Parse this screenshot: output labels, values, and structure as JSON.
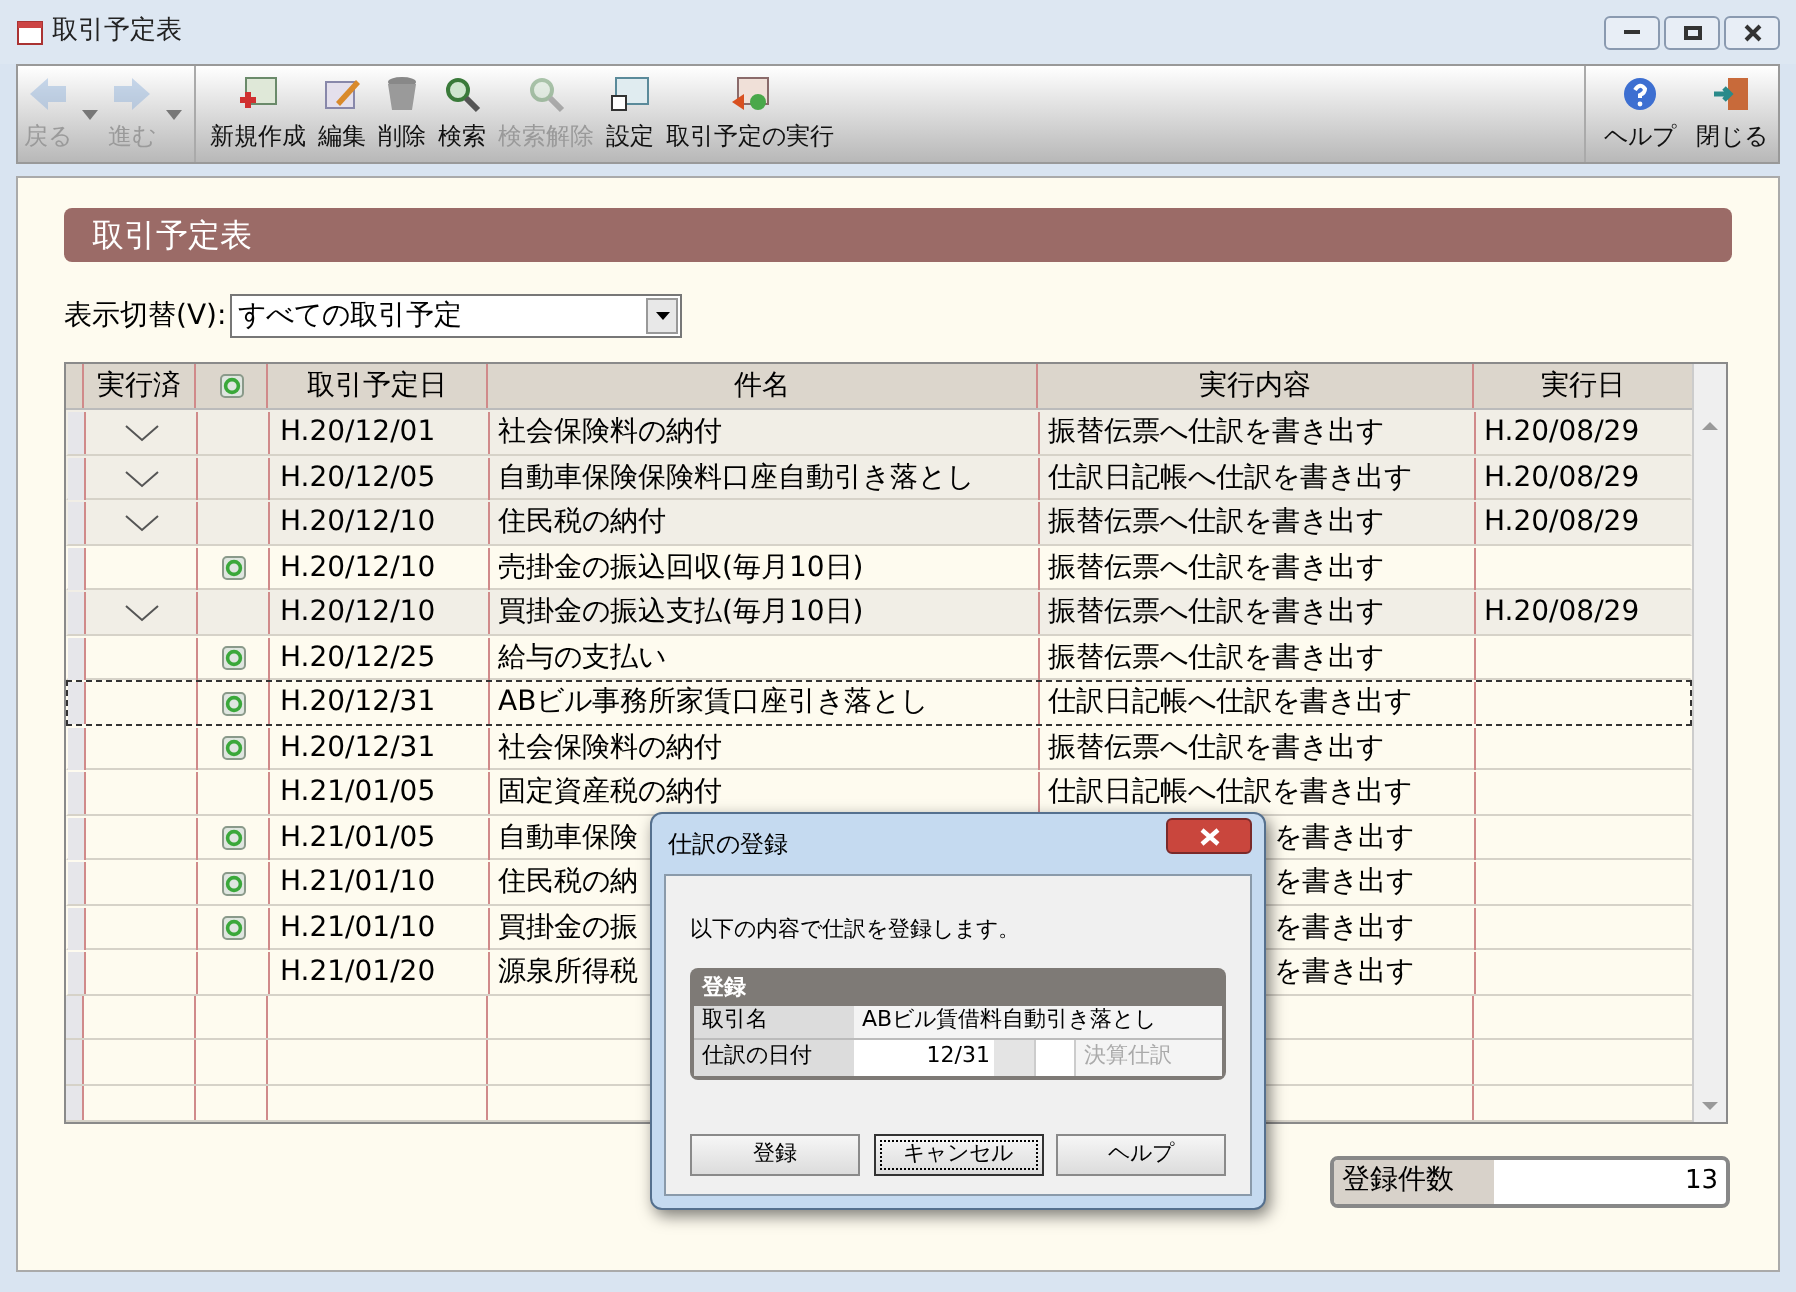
{
  "window": {
    "title": "取引予定表"
  },
  "toolbar": [
    {
      "label": "戻る",
      "disabled": true,
      "caret": true
    },
    {
      "label": "進む",
      "disabled": true,
      "caret": true
    },
    {
      "label": "新規作成",
      "disabled": false,
      "caret": false
    },
    {
      "label": "編集",
      "disabled": false,
      "caret": false
    },
    {
      "label": "削除",
      "disabled": false,
      "caret": false
    },
    {
      "label": "検索",
      "disabled": false,
      "caret": false
    },
    {
      "label": "検索解除",
      "disabled": true,
      "caret": false
    },
    {
      "label": "設定",
      "disabled": false,
      "caret": false
    },
    {
      "label": "取引予定の実行",
      "disabled": false,
      "caret": false
    }
  ],
  "toolbar_right": [
    {
      "label": "ヘルプ"
    },
    {
      "label": "閉じる"
    }
  ],
  "page_title": "取引予定表",
  "view_switch": {
    "label": "表示切替(V):",
    "value": "すべての取引予定"
  },
  "table": {
    "columns": [
      "実行済",
      "",
      "取引予定日",
      "件名",
      "実行内容",
      "実行日"
    ],
    "rows": [
      {
        "executed": true,
        "recurring": false,
        "date": "H.20/12/01",
        "name": "社会保険料の納付",
        "content": "振替伝票へ仕訳を書き出す",
        "content_cut": false,
        "exec_date": "H.20/08/29",
        "selected": false
      },
      {
        "executed": true,
        "recurring": false,
        "date": "H.20/12/05",
        "name": "自動車保険保険料口座自動引き落とし",
        "content": "仕訳日記帳へ仕訳を書き出す",
        "content_cut": false,
        "exec_date": "H.20/08/29",
        "selected": false
      },
      {
        "executed": true,
        "recurring": false,
        "date": "H.20/12/10",
        "name": "住民税の納付",
        "content": "振替伝票へ仕訳を書き出す",
        "content_cut": false,
        "exec_date": "H.20/08/29",
        "selected": false
      },
      {
        "executed": false,
        "recurring": true,
        "date": "H.20/12/10",
        "name": "売掛金の振込回収(毎月10日)",
        "content": "振替伝票へ仕訳を書き出す",
        "content_cut": false,
        "exec_date": "",
        "selected": false
      },
      {
        "executed": true,
        "recurring": false,
        "date": "H.20/12/10",
        "name": "買掛金の振込支払(毎月10日)",
        "content": "振替伝票へ仕訳を書き出す",
        "content_cut": false,
        "exec_date": "H.20/08/29",
        "selected": false
      },
      {
        "executed": false,
        "recurring": true,
        "date": "H.20/12/25",
        "name": "給与の支払い",
        "content": "振替伝票へ仕訳を書き出す",
        "content_cut": false,
        "exec_date": "",
        "selected": false
      },
      {
        "executed": false,
        "recurring": true,
        "date": "H.20/12/31",
        "name": "ABビル事務所家賃口座引き落とし",
        "content": "仕訳日記帳へ仕訳を書き出す",
        "content_cut": false,
        "exec_date": "",
        "selected": true
      },
      {
        "executed": false,
        "recurring": true,
        "date": "H.20/12/31",
        "name": "社会保険料の納付",
        "content": "振替伝票へ仕訳を書き出す",
        "content_cut": false,
        "exec_date": "",
        "selected": false
      },
      {
        "executed": false,
        "recurring": false,
        "date": "H.21/01/05",
        "name": "固定資産税の納付",
        "content": "仕訳日記帳へ仕訳を書き出す",
        "content_cut": false,
        "exec_date": "",
        "selected": false
      },
      {
        "executed": false,
        "recurring": true,
        "date": "H.21/01/05",
        "name": "自動車保険",
        "content": "を書き出す",
        "content_cut": true,
        "exec_date": "",
        "selected": false
      },
      {
        "executed": false,
        "recurring": true,
        "date": "H.21/01/10",
        "name": "住民税の納",
        "content": "を書き出す",
        "content_cut": true,
        "exec_date": "",
        "selected": false
      },
      {
        "executed": false,
        "recurring": true,
        "date": "H.21/01/10",
        "name": "買掛金の振",
        "content": "を書き出す",
        "content_cut": true,
        "exec_date": "",
        "selected": false
      },
      {
        "executed": false,
        "recurring": false,
        "date": "H.21/01/20",
        "name": "源泉所得税",
        "content": "を書き出す",
        "content_cut": true,
        "exec_date": "",
        "selected": false
      }
    ]
  },
  "count": {
    "label": "登録件数",
    "value": "13"
  },
  "dialog": {
    "title": "仕訳の登録",
    "message": "以下の内容で仕訳を登録します。",
    "section": "登録",
    "name_label": "取引名",
    "name_value": "ABビル賃借料自動引き落とし",
    "date_label": "仕訳の日付",
    "date_value": "12/31",
    "closing": {
      "label": "決算仕訳",
      "disabled": true
    },
    "buttons": [
      {
        "label": "登録",
        "focused": false
      },
      {
        "label": "キャンセル",
        "focused": true
      },
      {
        "label": "ヘルプ",
        "focused": false
      }
    ]
  }
}
